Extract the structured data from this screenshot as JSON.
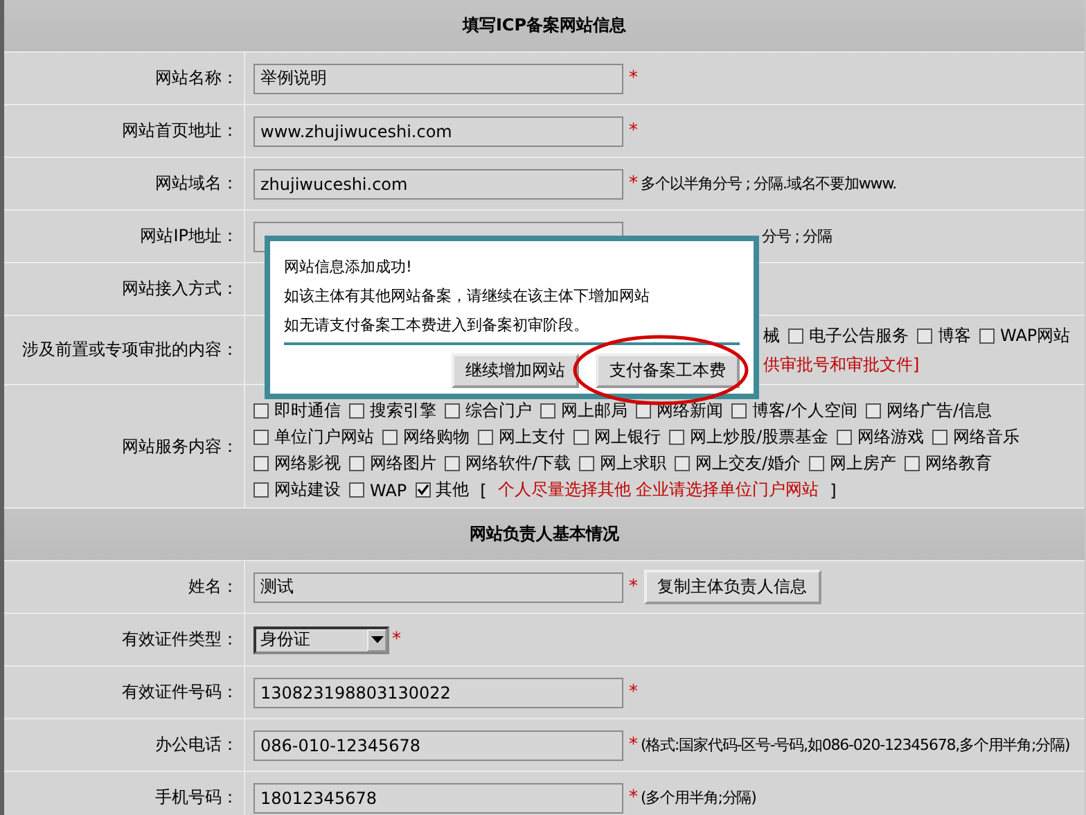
{
  "sections": [
    {
      "title": "填写ICP备案网站信息",
      "rows": [
        {
          "kind": "text",
          "label": "网站名称：",
          "value": "举例说明",
          "mark": "*"
        },
        {
          "kind": "text",
          "label": "网站首页地址：",
          "value": "www.zhujiwuceshi.com",
          "mark": "*"
        },
        {
          "kind": "text",
          "label": "网站域名：",
          "value": "zhujiwuceshi.com",
          "mark": "*",
          "hint": "多个以半角分号 ; 分隔.域名不要加www."
        },
        {
          "kind": "covered",
          "label": "网站IP地址：",
          "hint": "分号 ; 分隔"
        },
        {
          "kind": "blank",
          "label": "网站接入方式："
        },
        {
          "kind": "checks",
          "label": "涉及前置或专项审批的内容：",
          "lines": [
            {
              "items": [
                {
                  "kind": "text",
                  "label": "械"
                },
                {
                  "kind": "check",
                  "label": "电子公告服务",
                  "checked": false
                },
                {
                  "kind": "check",
                  "label": "博客",
                  "checked": false
                },
                {
                  "kind": "check",
                  "label": "WAP网站",
                  "checked": false
                }
              ]
            }
          ],
          "note": "供审批号和审批文件]"
        },
        {
          "kind": "checks",
          "label": "网站服务内容：",
          "lines": [
            {
              "items": [
                {
                  "kind": "check",
                  "label": "即时通信",
                  "checked": false
                },
                {
                  "kind": "check",
                  "label": "搜索引擎",
                  "checked": false
                },
                {
                  "kind": "check",
                  "label": "综合门户",
                  "checked": false
                },
                {
                  "kind": "check",
                  "label": "网上邮局",
                  "checked": false
                },
                {
                  "kind": "check",
                  "label": "网络新闻",
                  "checked": false
                },
                {
                  "kind": "check",
                  "label": "博客/个人空间",
                  "checked": false
                },
                {
                  "kind": "check",
                  "label": "网络广告/信息",
                  "checked": false
                }
              ]
            },
            {
              "items": [
                {
                  "kind": "check",
                  "label": "单位门户网站",
                  "checked": false
                },
                {
                  "kind": "check",
                  "label": "网络购物",
                  "checked": false
                },
                {
                  "kind": "check",
                  "label": "网上支付",
                  "checked": false
                },
                {
                  "kind": "check",
                  "label": "网上银行",
                  "checked": false
                },
                {
                  "kind": "check",
                  "label": "网上炒股/股票基金",
                  "checked": false
                },
                {
                  "kind": "check",
                  "label": "网络游戏",
                  "checked": false
                },
                {
                  "kind": "check",
                  "label": "网络音乐",
                  "checked": false
                }
              ]
            },
            {
              "items": [
                {
                  "kind": "check",
                  "label": "网络影视",
                  "checked": false
                },
                {
                  "kind": "check",
                  "label": "网络图片",
                  "checked": false
                },
                {
                  "kind": "check",
                  "label": "网络软件/下载",
                  "checked": false
                },
                {
                  "kind": "check",
                  "label": "网上求职",
                  "checked": false
                },
                {
                  "kind": "check",
                  "label": "网上交友/婚介",
                  "checked": false
                },
                {
                  "kind": "check",
                  "label": "网上房产",
                  "checked": false
                },
                {
                  "kind": "check",
                  "label": "网络教育",
                  "checked": false
                }
              ]
            },
            {
              "items": [
                {
                  "kind": "check",
                  "label": "网站建设",
                  "checked": false
                },
                {
                  "kind": "check",
                  "label": "WAP",
                  "checked": false
                },
                {
                  "kind": "check",
                  "label": "其他",
                  "checked": true
                }
              ],
              "bracket_open": "[",
              "bracket_note": "个人尽量选择其他 企业请选择单位门户网站",
              "bracket_close": "]"
            }
          ]
        }
      ]
    },
    {
      "title": "网站负责人基本情况",
      "rows": [
        {
          "kind": "text",
          "label": "姓名：",
          "value": "测试",
          "mark": "*",
          "button": "复制主体负责人信息"
        },
        {
          "kind": "select",
          "label": "有效证件类型：",
          "value": "身份证",
          "mark": "*"
        },
        {
          "kind": "text",
          "label": "有效证件号码：",
          "value": "130823198803130022",
          "mark": "*"
        },
        {
          "kind": "text",
          "label": "办公电话：",
          "value": "086-010-12345678",
          "mark": "*",
          "hint": "(格式:国家代码-区号-号码,如086-020-12345678,多个用半角;分隔)"
        },
        {
          "kind": "text",
          "label": "手机号码：",
          "value": "18012345678",
          "mark": "*",
          "hint": "(多个用半角;分隔)"
        }
      ]
    }
  ],
  "dialog": {
    "lines": [
      "网站信息添加成功!",
      "如该主体有其他网站备案，请继续在该主体下增加网站",
      "如无请支付备案工本费进入到备案初审阶段。"
    ],
    "buttons": [
      {
        "label": "继续增加网站",
        "highlighted": false
      },
      {
        "label": "支付备案工本费",
        "highlighted": true
      }
    ]
  }
}
